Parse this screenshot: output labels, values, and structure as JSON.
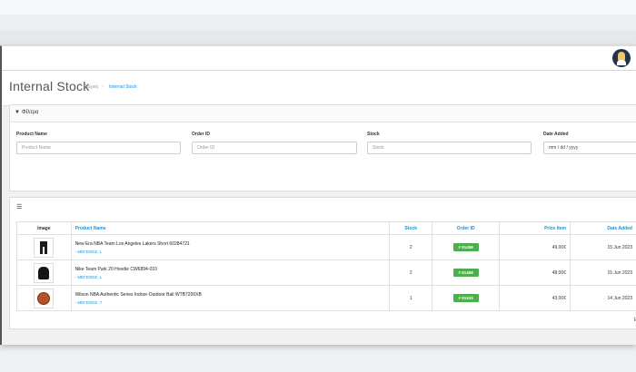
{
  "page": {
    "title": "Internal Stock",
    "breadcrumb_home": "Αρχική",
    "breadcrumb_sep": "›",
    "breadcrumb_current": "Internal Stock"
  },
  "header": {
    "avatar_icon": "user-avatar-icon"
  },
  "filter": {
    "title": "Φίλτρα",
    "icon": "filter-icon",
    "fields": [
      {
        "label": "Product Name",
        "placeholder": "Product Name"
      },
      {
        "label": "Order ID",
        "placeholder": "Order ID"
      },
      {
        "label": "Stock",
        "placeholder": "Stock"
      },
      {
        "label": "Date Added",
        "placeholder": "mm / dd / yyyy"
      }
    ]
  },
  "list": {
    "icon": "list-icon",
    "icon_glyph": "☰",
    "columns": {
      "image": "Image",
      "product": "Product Name",
      "stock": "Stock",
      "order": "Order ID",
      "price": "Price Item",
      "date": "Date Added"
    },
    "rows": [
      {
        "name": "New Era NBA Team Los Angeles Lakers Short 60284721",
        "option": "- ΜΕΓΕΘΟΣ: L",
        "stock": "2",
        "order": "# 91458",
        "price": "49,00€",
        "date": "15 Jun 2023",
        "thumb": "shorts"
      },
      {
        "name": "Nike Team Park 20 Hoodie CW6894-010",
        "option": "- ΜΕΓΕΘΟΣ: L",
        "stock": "2",
        "order": "# 91458",
        "price": "48,00€",
        "date": "15 Jun 2023",
        "thumb": "hoodie"
      },
      {
        "name": "Wilson NBA Authentic Series Indoor-Outdoor Ball WTB7200XB",
        "option": "- ΜΕΓΕΘΟΣ: 7",
        "stock": "1",
        "order": "# 91533",
        "price": "43,00€",
        "date": "14 Jun 2023",
        "thumb": "ball"
      }
    ],
    "pager_text": "E"
  },
  "colors": {
    "accent": "#1e91cf",
    "badge": "#4cae4c"
  }
}
